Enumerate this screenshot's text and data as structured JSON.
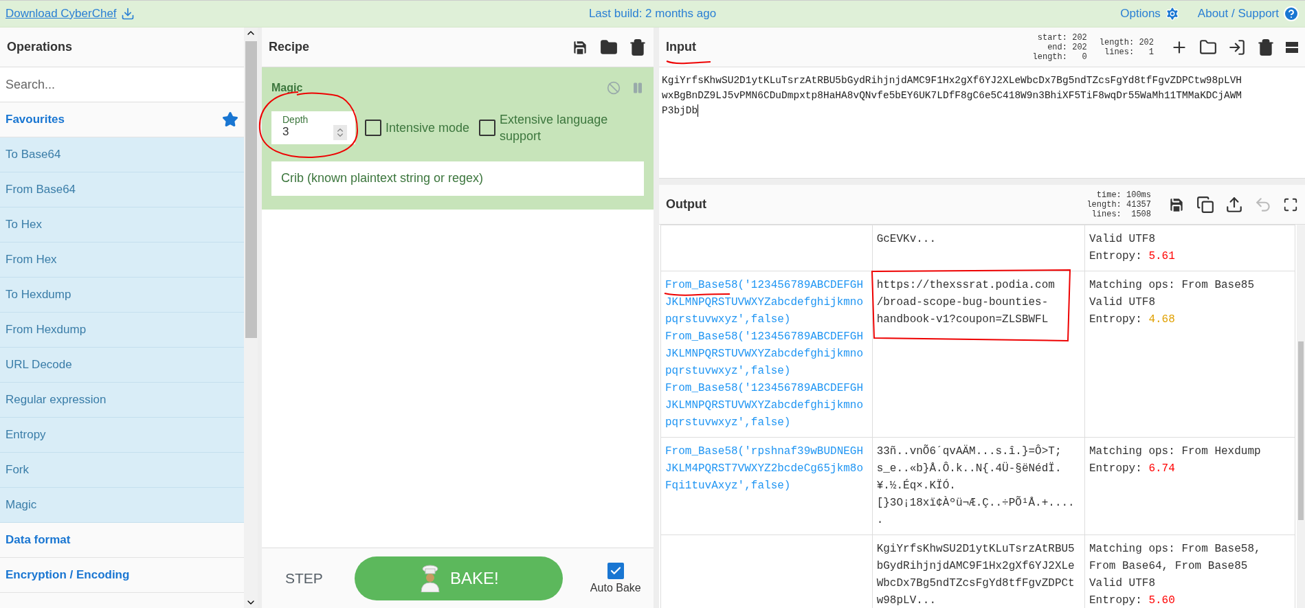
{
  "top_bar": {
    "download_link": "Download CyberChef",
    "last_build": "Last build: 2 months ago",
    "options": "Options",
    "about": "About / Support"
  },
  "operations": {
    "title": "Operations",
    "search": {
      "placeholder": "Search..."
    },
    "categories": [
      {
        "label": "Favourites",
        "items": [
          "To Base64",
          "From Base64",
          "To Hex",
          "From Hex",
          "To Hexdump",
          "From Hexdump",
          "URL Decode",
          "Regular expression",
          "Entropy",
          "Fork",
          "Magic"
        ]
      },
      {
        "label": "Data format"
      },
      {
        "label": "Encryption / Encoding"
      }
    ]
  },
  "recipe": {
    "title": "Recipe",
    "operation": {
      "name": "Magic",
      "depth": {
        "label": "Depth",
        "value": "3"
      },
      "checkboxes": [
        {
          "label": "Intensive mode",
          "checked": false
        },
        {
          "label": "Extensive language support",
          "checked": false
        }
      ],
      "crib": {
        "placeholder": "Crib (known plaintext string or regex)"
      }
    },
    "step": "STEP",
    "bake": "BAKE!",
    "auto_bake": {
      "label": "Auto Bake",
      "checked": true
    }
  },
  "input": {
    "title": "Input",
    "stats_left": [
      "start: 202",
      "end: 202",
      "length:   0"
    ],
    "stats_right": [
      "length: 202",
      "lines:   1"
    ],
    "lines": [
      "KgiYrfsKhwSU2D1ytKLuTsrzAtRBU5bGydRihjnjdAMC9F1Hx2gXf6YJ2XLeWbcDx7Bg5ndTZcsFgYd8tfFgvZDPCtw98pLVH",
      "wxBgBnDZ9LJ5vPMN6CDuDmpxtp8HaHA8vQNvfe5bEY6UK7LDfF8gC6e5C418W9n3BhiXF5TiF8wqDr55WaMh11TMMaKDCjAWM",
      "P3bjDb"
    ]
  },
  "output": {
    "title": "Output",
    "stats": [
      "time: 100ms",
      "length: 41357",
      "lines:  1508"
    ],
    "rows": [
      {
        "recipe": [],
        "result": [
          "GcEVKv..."
        ],
        "notes": [
          "Valid UTF8"
        ],
        "entropy": {
          "label": "Entropy:",
          "value": "5.61",
          "color": "#ff0000"
        }
      },
      {
        "recipe": [
          "From_Base58('123456789ABCDEFGHJKLMNPQRSTUVWXYZabcdefghijkmnopqrstuvwxyz',false)",
          "From_Base58('123456789ABCDEFGHJKLMNPQRSTUVWXYZabcdefghijkmnopqrstuvwxyz',false)",
          "From_Base58('123456789ABCDEFGHJKLMNPQRSTUVWXYZabcdefghijkmnopqrstuvwxyz',false)"
        ],
        "result": [
          "https://thexssrat.podia.com",
          "/broad-scope-bug-bounties-",
          "handbook-v1?coupon=ZLSBWFL"
        ],
        "notes": [
          "Matching ops: From Base85",
          "Valid UTF8"
        ],
        "entropy": {
          "label": "Entropy:",
          "value": "4.68",
          "color": "#e0a000"
        }
      },
      {
        "recipe": [
          "From_Base58('rpshnaf39wBUDNEGHJKLM4PQRST7VWXYZ2bcdeCg65jkm8oFqi1tuvAxyz',false)"
        ],
        "result": [
          "33ñ..vnÕ6´qvAÄM...s.î.}=Ô>T;",
          "s_e..«b}Å.Ô.k..N{.4Ü-§ëNédÏ.",
          "¥.½.Éq×.KÏÓ.",
          "[}3O¡18xï¢Àºü¬Æ.Ç..÷PÕ¹Å.+....",
          "."
        ],
        "notes": [
          "Matching ops: From Hexdump"
        ],
        "entropy": {
          "label": "Entropy:",
          "value": "6.74",
          "color": "#ff0000"
        }
      },
      {
        "recipe": [],
        "result": [
          "KgiYrfsKhwSU2D1ytKLuTsrzAtRBU5",
          "bGydRihjnjdAMC9F1Hx2gXf6YJ2XLe",
          "WbcDx7Bg5ndTZcsFgYd8tfFgvZDPCt",
          "w98pLV..."
        ],
        "notes": [
          "Matching ops: From Base58, From Base64, From Base85",
          "Valid UTF8"
        ],
        "entropy": {
          "label": "Entropy:",
          "value": "5.60",
          "color": "#ff0000"
        }
      }
    ]
  }
}
